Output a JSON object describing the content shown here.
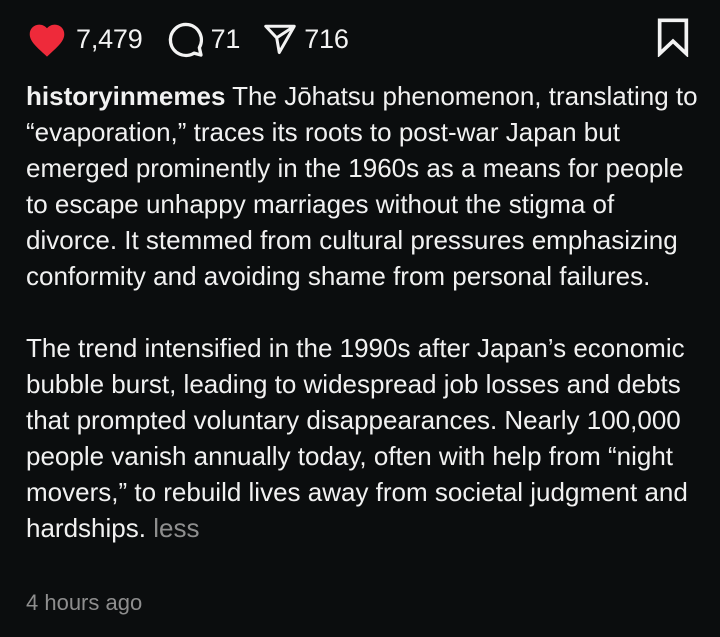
{
  "actions": {
    "like_icon": "heart-filled-icon",
    "like_color": "#ee2a3a",
    "likes": "7,479",
    "comment_icon": "comment-bubble-icon",
    "comments": "71",
    "share_icon": "paper-plane-icon",
    "shares": "716",
    "save_icon": "bookmark-icon"
  },
  "caption": {
    "username": "historyinmemes",
    "paragraph1": "The Jōhatsu phenomenon, translating to “evaporation,” traces its roots to post-war Japan but emerged prominently in the 1960s as a means for people to escape unhappy marriages without the stigma of divorce. It stemmed from cultural pressures emphasizing conformity and avoiding shame from personal failures.",
    "paragraph2": "The trend intensified in the 1990s after Japan’s economic bubble burst, leading to widespread job losses and debts that prompted voluntary disappearances. Nearly 100,000 people vanish annually today, often with help from “night movers,” to rebuild lives away from societal judgment and hardships.",
    "less_label": "less"
  },
  "timestamp": "4 hours ago",
  "colors": {
    "background": "#0b0d0e",
    "text": "#f1f1f1",
    "muted": "#8e8e8e"
  }
}
